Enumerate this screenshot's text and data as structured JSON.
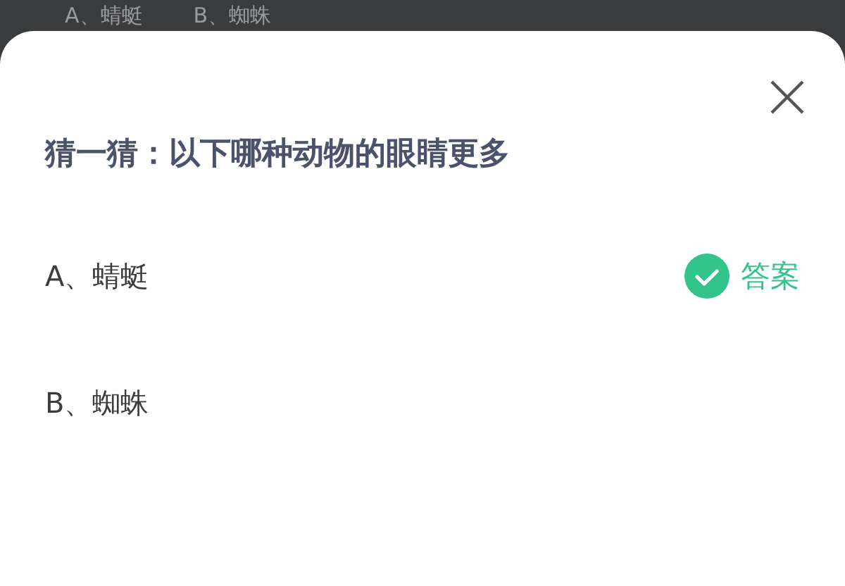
{
  "background": {
    "options": [
      "A、蜻蜓",
      "B、蜘蛛"
    ]
  },
  "dialog": {
    "title": "猜一猜：以下哪种动物的眼睛更多",
    "options": [
      {
        "label": "A、蜻蜓",
        "correct": true,
        "answer_label": "答案"
      },
      {
        "label": "B、蜘蛛",
        "correct": false
      }
    ]
  }
}
